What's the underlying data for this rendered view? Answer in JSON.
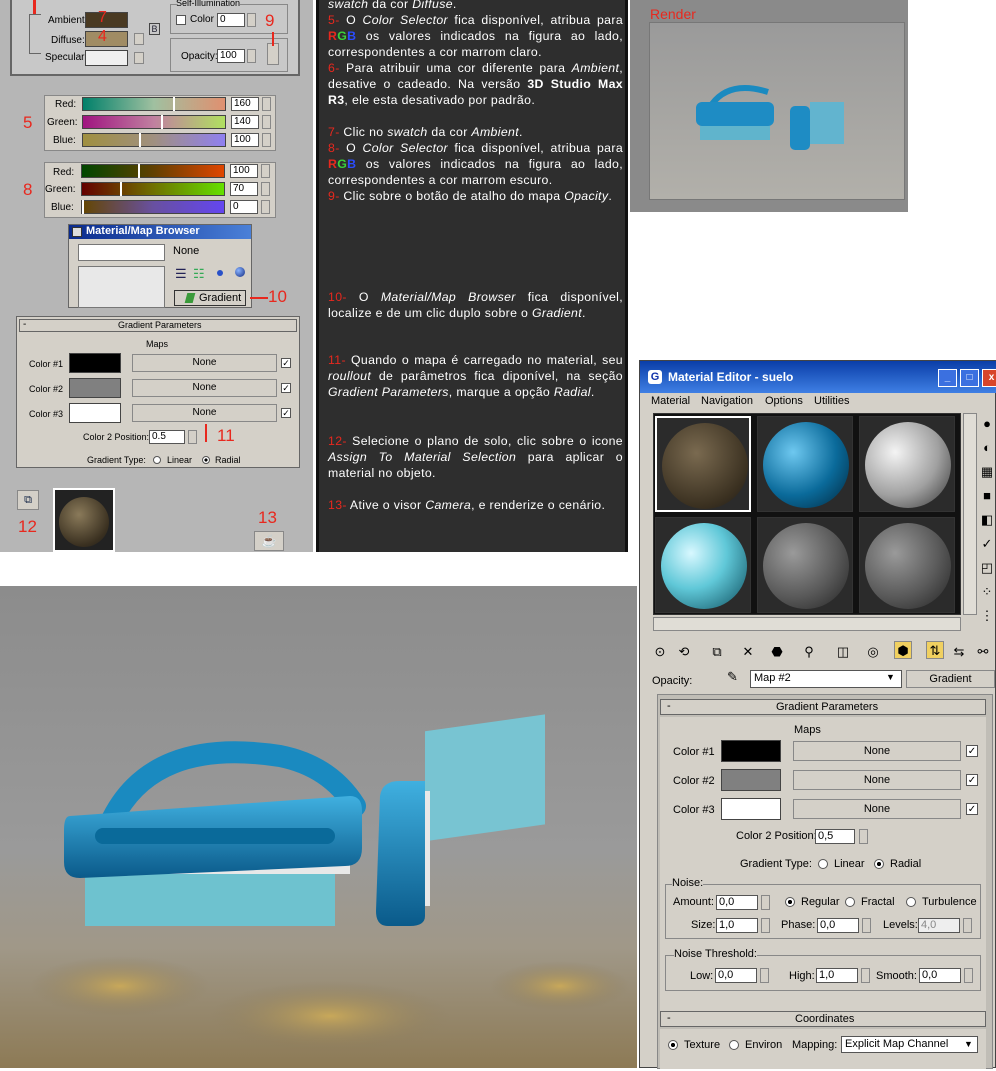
{
  "left_panel": {
    "ambient_label": "Ambient:",
    "diffuse_label": "Diffuse:",
    "specular_label": "Specular:",
    "self_illum_label": "Self-Illumination",
    "color_label": "Color",
    "color_value": "0",
    "opacity_label": "Opacity:",
    "opacity_value": "100",
    "step7": "7",
    "step4": "4",
    "step9": "9",
    "rgb1": {
      "step": "5",
      "red_label": "Red:",
      "green_label": "Green:",
      "blue_label": "Blue:",
      "red": "160",
      "green": "140",
      "blue": "100"
    },
    "rgb2": {
      "step": "8",
      "red_label": "Red:",
      "green_label": "Green:",
      "blue_label": "Blue:",
      "red": "100",
      "green": "70",
      "blue": "0"
    },
    "browser_title": "Material/Map Browser",
    "browser_none": "None",
    "gradient_item": "Gradient",
    "step10": "10",
    "gradient_params": {
      "title": "Gradient Parameters",
      "maps": "Maps",
      "color1": "Color #1",
      "color2": "Color #2",
      "color3": "Color #3",
      "none": "None",
      "pos_label": "Color 2 Position:",
      "pos_value": "0.5",
      "type_label": "Gradient Type:",
      "linear": "Linear",
      "radial": "Radial"
    },
    "step11": "11",
    "step12": "12",
    "step13": "13"
  },
  "text_panel": {
    "intro_swatch": "swatch",
    "intro_rest": " da cor ",
    "intro_diffuse": "Diffuse",
    "p5_num": "5-",
    "p5_a": " O ",
    "p5_b": "Color Selector",
    "p5_c": " fica disponível, atribua para ",
    "p5_d": " os valores indicados na figura ao lado, correspondentes a cor marrom claro.",
    "p6_num": "6-",
    "p6_a": " Para atribuir uma cor diferente para ",
    "p6_b": "Ambient",
    "p6_c": ", desative o cadeado. Na versão ",
    "p6_d": "3D Studio Max R3",
    "p6_e": ", ele esta desativado por padrão.",
    "p7_num": "7-",
    "p7_a": " Clic no ",
    "p7_b": "swatch",
    "p7_c": " da cor ",
    "p7_d": "Ambient",
    "p8_num": "8-",
    "p8_d": " os valores indicados na figura ao lado, correspondentes a cor marrom escuro.",
    "p9_num": "9-",
    "p9_a": " Clic sobre o botão de atalho do mapa ",
    "p9_b": "Opacity",
    "p10_num": "10-",
    "p10_a": " O ",
    "p10_b": "Material/Map Browser",
    "p10_c": " fica disponível, localize e de um clic duplo sobre o ",
    "p10_d": "Gradient",
    "p11_num": "11-",
    "p11_a": " Quando o mapa é carregado no material, seu ",
    "p11_b": "roullout",
    "p11_c": " de parâmetros fica diponível, na seção ",
    "p11_d": "Gradient Parameters",
    "p11_e": ", marque a opção ",
    "p11_f": "Radial",
    "p12_num": "12-",
    "p12_a": " Selecione o plano de solo, clic sobre o icone ",
    "p12_b": "Assign To Material Selection",
    "p12_c": " para aplicar o material no objeto.",
    "p13_num": "13-",
    "p13_a": " Ative o visor ",
    "p13_b": "Camera",
    "p13_c": ", e renderize o cenário.",
    "rgb_r": "R",
    "rgb_g": "G",
    "rgb_b": "B"
  },
  "render_thumb": {
    "label": "Render"
  },
  "material_editor": {
    "title": "Material Editor - suelo",
    "menu": [
      "Material",
      "Navigation",
      "Options",
      "Utilities"
    ],
    "opacity_label": "Opacity:",
    "map_name": "Map #2",
    "map_type": "Gradient",
    "gradient": {
      "title": "Gradient Parameters",
      "maps": "Maps",
      "color1": "Color #1",
      "color2": "Color #2",
      "color3": "Color #3",
      "none": "None",
      "pos_label": "Color 2 Position:",
      "pos_value": "0,5",
      "type_label": "Gradient Type:",
      "linear": "Linear",
      "radial": "Radial"
    },
    "noise": {
      "title": "Noise:",
      "amount_label": "Amount:",
      "amount": "0,0",
      "regular": "Regular",
      "fractal": "Fractal",
      "turbulence": "Turbulence",
      "size_label": "Size:",
      "size": "1,0",
      "phase_label": "Phase:",
      "phase": "0,0",
      "levels_label": "Levels:",
      "levels": "4,0"
    },
    "threshold": {
      "title": "Noise Threshold:",
      "low_label": "Low:",
      "low": "0,0",
      "high_label": "High:",
      "high": "1,0",
      "smooth_label": "Smooth:",
      "smooth": "0,0"
    },
    "coords": {
      "title": "Coordinates",
      "texture": "Texture",
      "environ": "Environ",
      "mapping_label": "Mapping:",
      "mapping": "Explicit Map Channel"
    }
  }
}
